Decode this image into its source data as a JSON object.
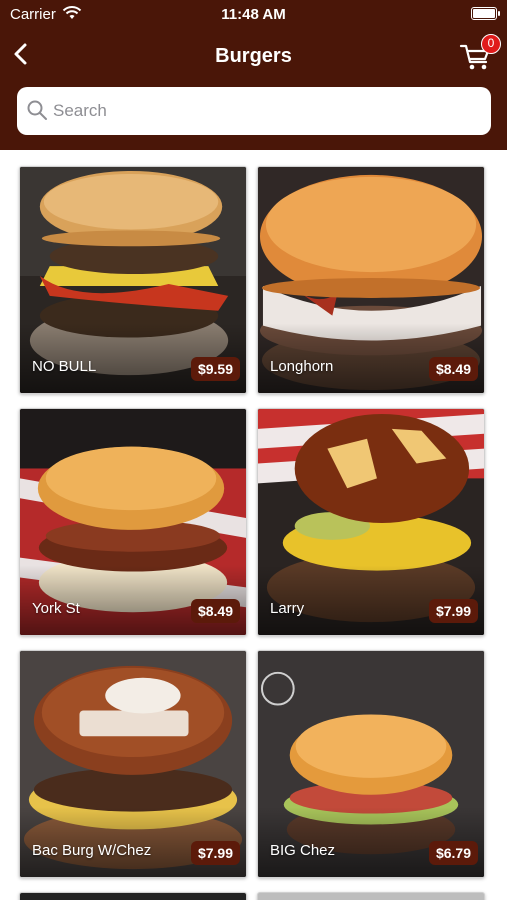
{
  "status": {
    "carrier": "Carrier",
    "time": "11:48 AM"
  },
  "header": {
    "title": "Burgers",
    "cart_count": "0"
  },
  "search": {
    "placeholder": "Search",
    "value": ""
  },
  "products": [
    {
      "name": "NO BULL",
      "price": "$9.59"
    },
    {
      "name": "Longhorn",
      "price": "$8.49"
    },
    {
      "name": "York St",
      "price": "$8.49"
    },
    {
      "name": "Larry",
      "price": "$7.99"
    },
    {
      "name": "Bac Burg  W/Chez",
      "price": "$7.99"
    },
    {
      "name": "BIG Chez",
      "price": "$6.79"
    }
  ],
  "colors": {
    "header_bg": "#4a1608",
    "price_bg": "#5c1a0a",
    "badge": "#e01b1b"
  }
}
